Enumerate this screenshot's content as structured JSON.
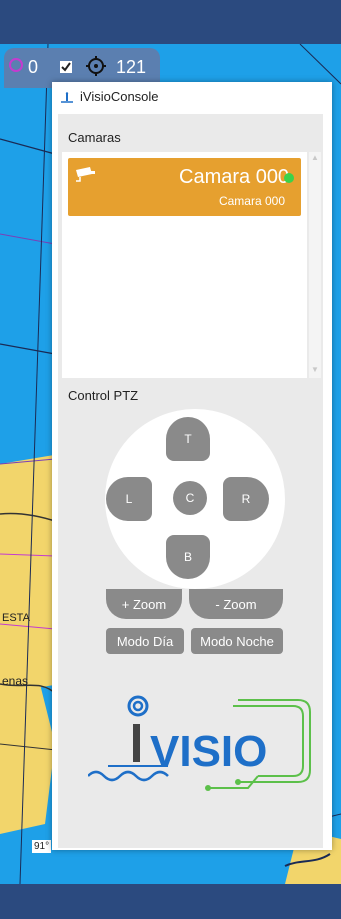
{
  "map_toolbar": {
    "count_a": "0",
    "count_b": "121"
  },
  "window": {
    "title": "iVisioConsole"
  },
  "cameras": {
    "section_label": "Camaras",
    "items": [
      {
        "name": "Camara 000",
        "subtitle": "Camara 000",
        "status": "online"
      }
    ]
  },
  "ptz": {
    "section_label": "Control PTZ",
    "up": "T",
    "down": "B",
    "left": "L",
    "right": "R",
    "center": "C",
    "zoom_in": "+ Zoom",
    "zoom_out": "- Zoom",
    "day_mode": "Modo Día",
    "night_mode": "Modo Noche"
  },
  "map_labels": {
    "label_a": "ESTA",
    "label_b": "enas",
    "label_c": "91°"
  },
  "logo": {
    "text": "VISIO"
  },
  "colors": {
    "accent": "#e6a02f",
    "ptz_button": "#8a8a8a",
    "status_online": "#3ad24a",
    "map_sea": "#1ea0e8",
    "bar": "#2b4a7f",
    "logo_blue": "#1e6fc8",
    "logo_green": "#5cc04a"
  }
}
